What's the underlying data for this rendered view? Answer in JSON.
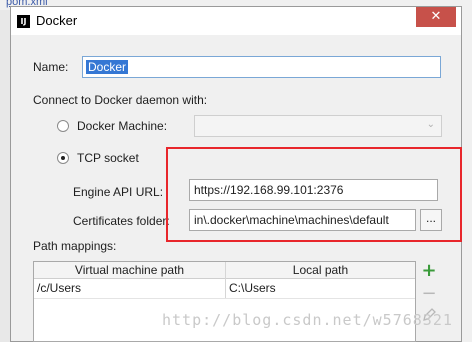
{
  "background": {
    "tab_text": "pom.xml"
  },
  "window": {
    "title": "Docker",
    "close_glyph": "✕",
    "icon_text": "IJ"
  },
  "name": {
    "label": "Name:",
    "value": "Docker"
  },
  "connect": {
    "label": "Connect to Docker daemon with:"
  },
  "docker_machine": {
    "label": "Docker Machine:",
    "selected": false,
    "value": ""
  },
  "tcp_socket": {
    "label": "TCP socket",
    "selected": true,
    "engine_api_url": {
      "label": "Engine API URL:",
      "value": "https://192.168.99.101:2376"
    },
    "certificates_folder": {
      "label": "Certificates folder:",
      "value": "in\\.docker\\machine\\machines\\default",
      "browse_label": "..."
    }
  },
  "path_mappings": {
    "label": "Path mappings:",
    "columns": [
      "Virtual machine path",
      "Local path"
    ],
    "rows": [
      [
        "/c/Users",
        "C:\\Users"
      ]
    ],
    "add_glyph": "+",
    "remove_glyph": "−"
  },
  "watermark": "http://blog.csdn.net/w5768321",
  "colors": {
    "highlight": "#e8262b",
    "selection": "#3477d4",
    "add": "#3b9b3b"
  }
}
